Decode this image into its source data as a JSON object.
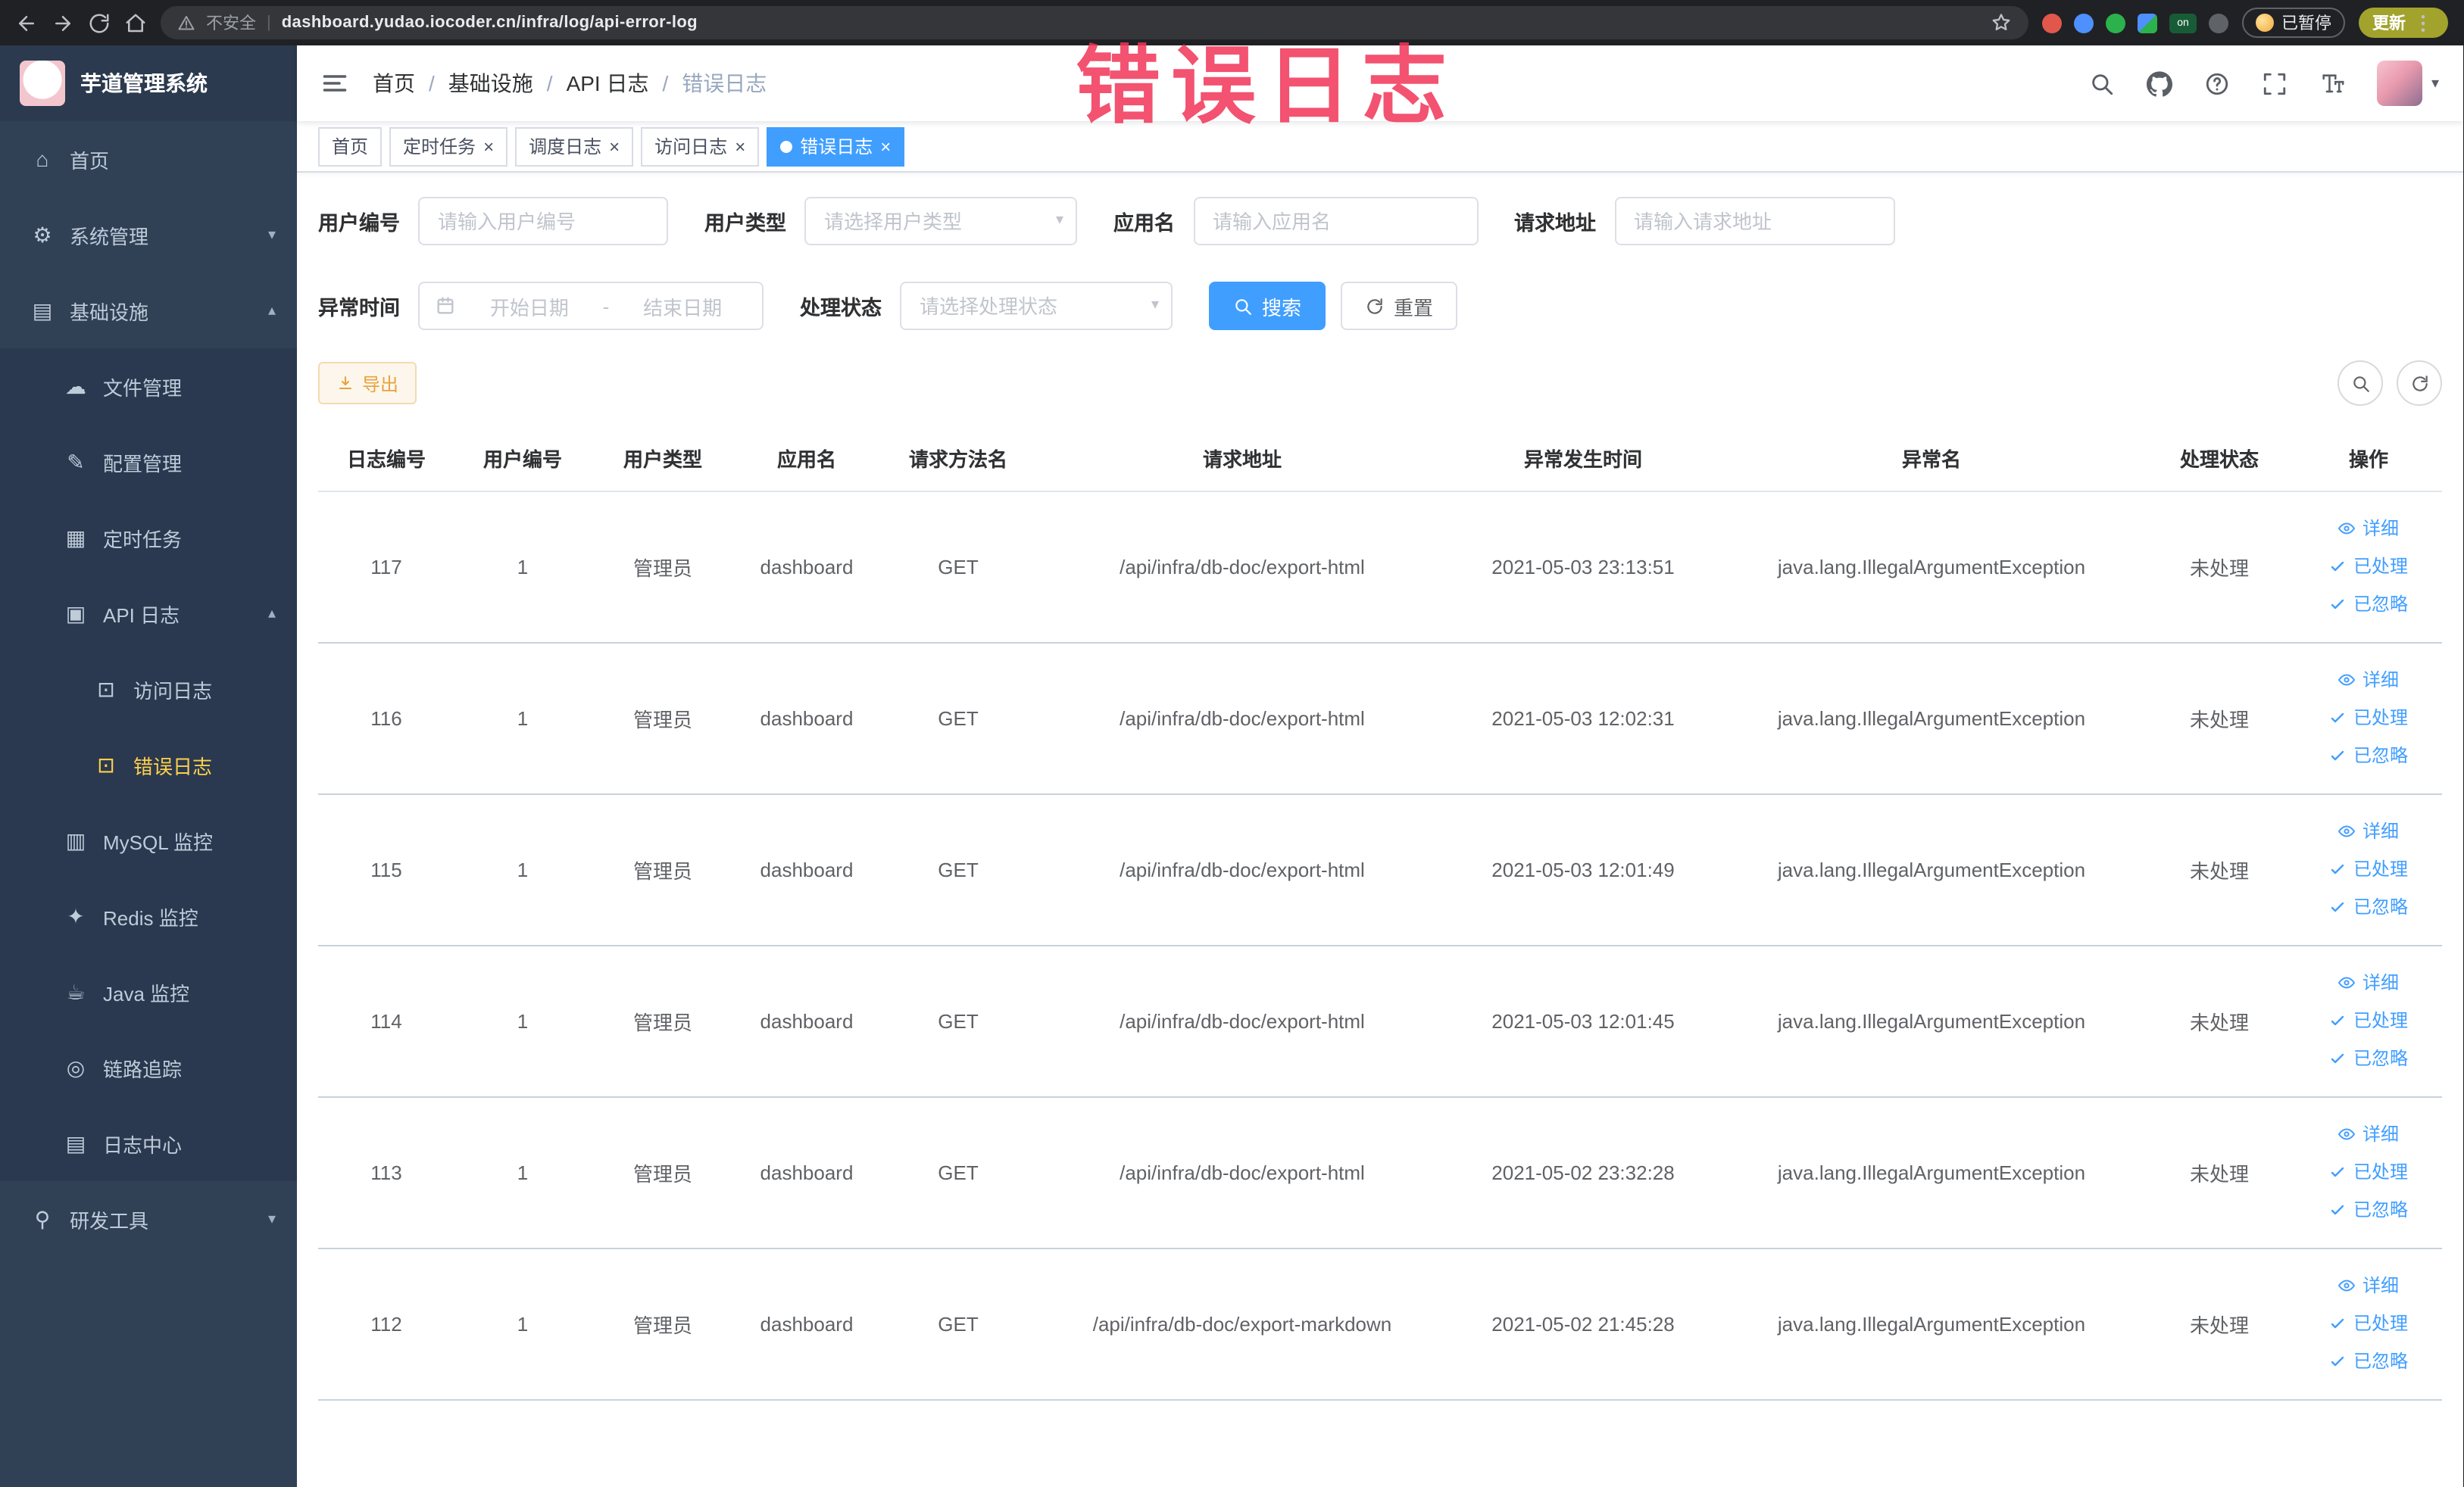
{
  "colors": {
    "accent": "#409eff",
    "sidebar_bg": "#304156",
    "active_menu_text": "#ffd04b",
    "active_tab_bg": "#409eff",
    "export_button_text": "#e6a23c",
    "stamp_text": "#f23558",
    "browser_chrome_bg": "#202124"
  },
  "overlay_stamp": "错误日志",
  "browser": {
    "security_label": "不安全",
    "url": "dashboard.yudao.iocoder.cn/infra/log/api-error-log",
    "paused_badge": "已暂停",
    "update_button": "更新",
    "extension_on_badge": "on"
  },
  "sidebar": {
    "title": "芋道管理系统",
    "home": "首页",
    "system_mgmt": "系统管理",
    "infrastructure": "基础设施",
    "file_mgmt": "文件管理",
    "config_mgmt": "配置管理",
    "scheduled_jobs": "定时任务",
    "api_log": "API 日志",
    "access_log": "访问日志",
    "error_log": "错误日志",
    "mysql_monitor": "MySQL 监控",
    "redis_monitor": "Redis 监控",
    "java_monitor": "Java 监控",
    "trace": "链路追踪",
    "log_center": "日志中心",
    "dev_tools": "研发工具"
  },
  "navbar": {
    "breadcrumb": [
      "首页",
      "基础设施",
      "API 日志",
      "错误日志"
    ]
  },
  "tabs": [
    {
      "label": "首页",
      "active": false,
      "closable": false
    },
    {
      "label": "定时任务",
      "active": false,
      "closable": true
    },
    {
      "label": "调度日志",
      "active": false,
      "closable": true
    },
    {
      "label": "访问日志",
      "active": false,
      "closable": true
    },
    {
      "label": "错误日志",
      "active": true,
      "closable": true
    }
  ],
  "filters": {
    "user_id": {
      "label": "用户编号",
      "placeholder": "请输入用户编号"
    },
    "user_type": {
      "label": "用户类型",
      "placeholder": "请选择用户类型"
    },
    "app_name": {
      "label": "应用名",
      "placeholder": "请输入应用名"
    },
    "request_url": {
      "label": "请求地址",
      "placeholder": "请输入请求地址"
    },
    "exception_time": {
      "label": "异常时间",
      "start_placeholder": "开始日期",
      "separator": "-",
      "end_placeholder": "结束日期"
    },
    "process_status": {
      "label": "处理状态",
      "placeholder": "请选择处理状态"
    },
    "search_button": "搜索",
    "reset_button": "重置"
  },
  "toolbar": {
    "export_button": "导出"
  },
  "table": {
    "columns": [
      "日志编号",
      "用户编号",
      "用户类型",
      "应用名",
      "请求方法名",
      "请求地址",
      "异常发生时间",
      "异常名",
      "处理状态",
      "操作"
    ],
    "row_actions": [
      "详细",
      "已处理",
      "已忽略"
    ],
    "rows": [
      {
        "id": "117",
        "user_id": "1",
        "user_type": "管理员",
        "app": "dashboard",
        "method": "GET",
        "url": "/api/infra/db-doc/export-html",
        "time": "2021-05-03 23:13:51",
        "exception": "java.lang.IllegalArgumentException",
        "status": "未处理"
      },
      {
        "id": "116",
        "user_id": "1",
        "user_type": "管理员",
        "app": "dashboard",
        "method": "GET",
        "url": "/api/infra/db-doc/export-html",
        "time": "2021-05-03 12:02:31",
        "exception": "java.lang.IllegalArgumentException",
        "status": "未处理"
      },
      {
        "id": "115",
        "user_id": "1",
        "user_type": "管理员",
        "app": "dashboard",
        "method": "GET",
        "url": "/api/infra/db-doc/export-html",
        "time": "2021-05-03 12:01:49",
        "exception": "java.lang.IllegalArgumentException",
        "status": "未处理"
      },
      {
        "id": "114",
        "user_id": "1",
        "user_type": "管理员",
        "app": "dashboard",
        "method": "GET",
        "url": "/api/infra/db-doc/export-html",
        "time": "2021-05-03 12:01:45",
        "exception": "java.lang.IllegalArgumentException",
        "status": "未处理"
      },
      {
        "id": "113",
        "user_id": "1",
        "user_type": "管理员",
        "app": "dashboard",
        "method": "GET",
        "url": "/api/infra/db-doc/export-html",
        "time": "2021-05-02 23:32:28",
        "exception": "java.lang.IllegalArgumentException",
        "status": "未处理"
      },
      {
        "id": "112",
        "user_id": "1",
        "user_type": "管理员",
        "app": "dashboard",
        "method": "GET",
        "url": "/api/infra/db-doc/export-markdown",
        "time": "2021-05-02 21:45:28",
        "exception": "java.lang.IllegalArgumentException",
        "status": "未处理"
      }
    ]
  }
}
